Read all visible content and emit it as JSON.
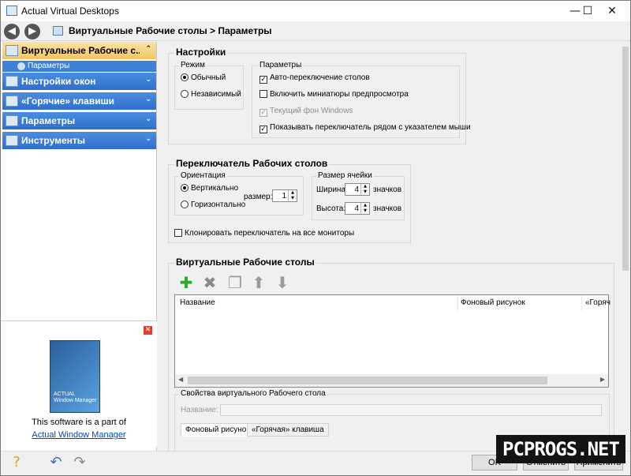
{
  "window": {
    "title": "Actual Virtual Desktops",
    "minimize": "—",
    "maximize": "☐",
    "close": "✕"
  },
  "nav": {
    "back": "◀",
    "forward": "▶",
    "breadcrumb": "Виртуальные Рабочие столы > Параметры"
  },
  "sidebar": {
    "categories": [
      {
        "label": "Виртуальные Рабочие с...",
        "chevron": "⌃",
        "icon": "desktop-icon"
      },
      {
        "label": "Настройки окон",
        "chevron": "⌄",
        "icon": "window-icon"
      },
      {
        "label": "«Горячие» клавиши",
        "chevron": "⌄",
        "icon": "keyboard-icon"
      },
      {
        "label": "Параметры",
        "chevron": "⌄",
        "icon": "settings-icon"
      },
      {
        "label": "Инструменты",
        "chevron": "⌄",
        "icon": "tools-icon"
      }
    ],
    "subitem": "Параметры"
  },
  "ad": {
    "close": "✕",
    "box_brand": "ACTUAL\nWindow Manager",
    "text": "This software is a part of",
    "link": "Actual Window Manager"
  },
  "settings": {
    "title": "Настройки",
    "mode": {
      "title": "Режим",
      "options": [
        "Обычный",
        "Независимый"
      ],
      "selected": 0
    },
    "params": {
      "title": "Параметры",
      "items": [
        {
          "label": "Авто-переключение столов",
          "checked": true,
          "disabled": false
        },
        {
          "label": "Включить миниатюры предпросмотра",
          "checked": false,
          "disabled": false
        },
        {
          "label": "Текущий фон Windows",
          "checked": true,
          "disabled": true
        },
        {
          "label": "Показывать переключатель рядом с указателем мыши",
          "checked": true,
          "disabled": false
        }
      ]
    }
  },
  "switcher": {
    "title": "Переключатель Рабочих столов",
    "orientation": {
      "title": "Ориентация",
      "options": [
        "Вертикально",
        "Горизонтально"
      ],
      "selected": 0,
      "size_label": "размер:",
      "size_value": "1"
    },
    "cell": {
      "title": "Размер ячейки",
      "width_label": "Ширина:",
      "width_value": "4",
      "height_label": "Высота:",
      "height_value": "4",
      "unit": "значков"
    },
    "clone": {
      "label": "Клонировать переключатель на все мониторы",
      "checked": false
    }
  },
  "desktops": {
    "title": "Виртуальные Рабочие столы",
    "toolbar": {
      "add": "✚",
      "delete": "✖",
      "copy": "❐",
      "up": "⬆",
      "down": "⬇"
    },
    "columns": [
      "Название",
      "Фоновый рисунок",
      "«Горяч"
    ],
    "properties_title": "Свойства виртуального Рабочего стола",
    "name_label": "Название:",
    "tabs": [
      "Фоновый рисунок",
      "«Горячая» клавиша"
    ]
  },
  "bottom": {
    "ok": "OK",
    "cancel": "Отменить",
    "apply": "Применить"
  },
  "watermark": "PCPROGS.NET"
}
